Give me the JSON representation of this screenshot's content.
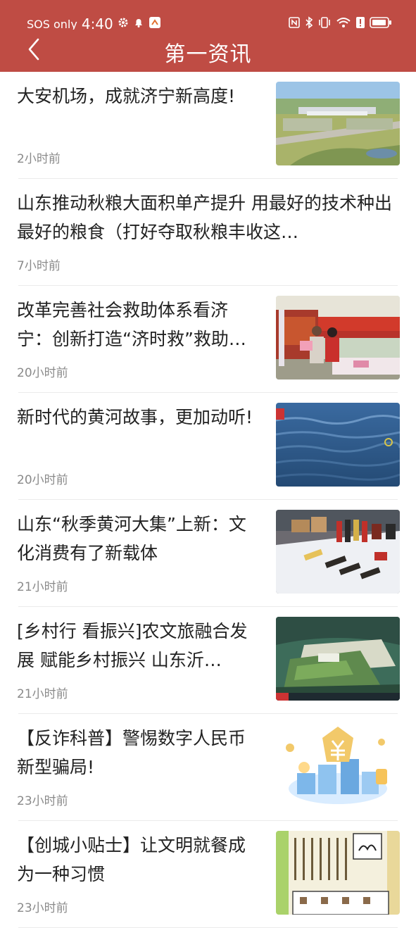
{
  "status_bar": {
    "network": "SOS only",
    "time": "4:40",
    "icons": [
      "gear-icon",
      "bell-icon",
      "app-notification-icon",
      "nfc-icon",
      "bluetooth-icon",
      "vibrate-icon",
      "wifi-icon",
      "alert-icon",
      "battery-icon"
    ]
  },
  "nav": {
    "title": "第一资讯",
    "back_icon": "chevron-left-icon",
    "bg_color": "#bf4c44"
  },
  "news": [
    {
      "headline": "大安机场，成就济宁新高度!",
      "time": "2小时前",
      "thumb": "airport"
    },
    {
      "headline": "山东推动秋粮大面积单产提升 用最好的技术种出最好的粮食（打好夺取秋粮丰收这…",
      "time": "7小时前",
      "thumb": null
    },
    {
      "headline": "改革完善社会救助体系看济宁：创新打造“济时救”救助…",
      "time": "20小时前",
      "thumb": "street-event"
    },
    {
      "headline": "新时代的黄河故事，更加动听!",
      "time": "20小时前",
      "thumb": "river-water"
    },
    {
      "headline": "山东“秋季黄河大集”上新：文化消费有了新载体",
      "time": "21小时前",
      "thumb": "market-stall"
    },
    {
      "headline": "[乡村行 看振兴]农文旅融合发展 赋能乡村振兴 山东沂…",
      "time": "21小时前",
      "thumb": "village-model"
    },
    {
      "headline": "【反诈科普】警惕数字人民币新型骗局!",
      "time": "23小时前",
      "thumb": "digital-yuan"
    },
    {
      "headline": "【创城小贴士】让文明就餐成为一种习惯",
      "time": "23小时前",
      "thumb": "poster"
    }
  ]
}
